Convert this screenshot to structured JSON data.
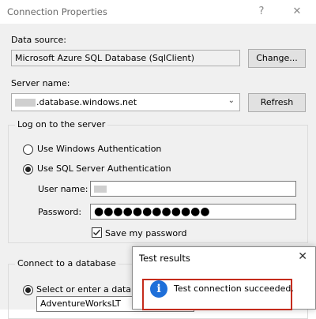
{
  "window": {
    "title": "Connection Properties",
    "help_label": "?",
    "close_label": "✕"
  },
  "data_source": {
    "label": "Data source:",
    "value": "Microsoft Azure SQL Database (SqlClient)",
    "change_button": "Change..."
  },
  "server": {
    "label": "Server name:",
    "value": ".database.windows.net",
    "refresh_button": "Refresh"
  },
  "logon": {
    "group_title": "Log on to the server",
    "windows_auth": "Use Windows Authentication",
    "sql_auth": "Use SQL Server Authentication",
    "selected": "sql_auth",
    "username_label": "User name:",
    "password_label": "Password:",
    "password_mask": "●●●●●●●●●●●●",
    "save_password_label": "Save my password",
    "save_password_checked": true
  },
  "database": {
    "group_title": "Connect to a database",
    "select_label": "Select or enter a database",
    "value": "AdventureWorksLT"
  },
  "popup": {
    "title": "Test results",
    "close_label": "✕",
    "icon_glyph": "i",
    "message": "Test connection succeeded."
  },
  "colors": {
    "accent_info": "#1e6fd9",
    "highlight_border": "#c42b1c"
  }
}
